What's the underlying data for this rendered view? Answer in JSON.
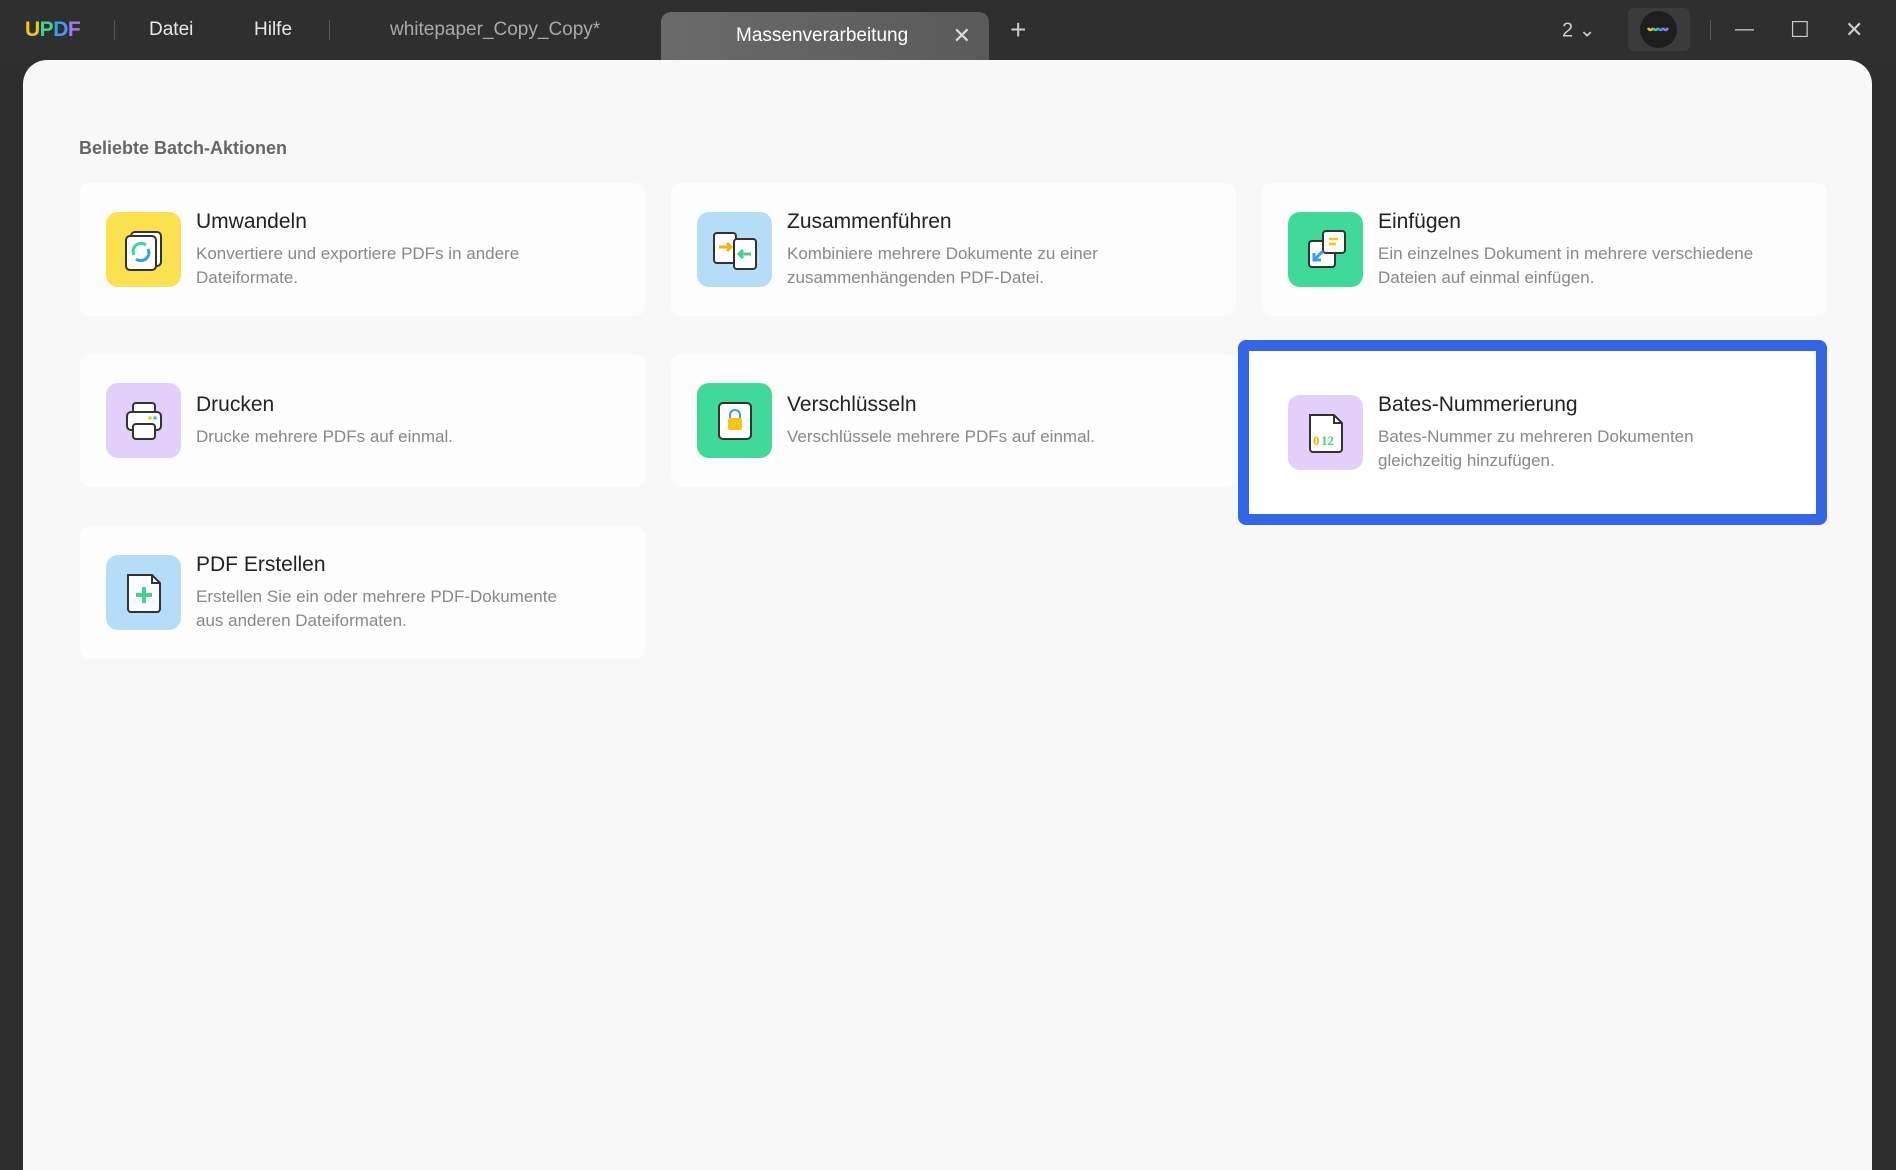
{
  "titlebar": {
    "logo": "UPDF",
    "menu": [
      "Datei",
      "Hilfe"
    ],
    "tabs": [
      {
        "label": "whitepaper_Copy_Copy*",
        "active": false
      },
      {
        "label": "Massenverarbeitung",
        "active": true
      }
    ],
    "add_tab": "+",
    "close_tab": "✕",
    "window_count": "2",
    "window_count_chevron": "⌄",
    "minimize": "—",
    "maximize": "☐",
    "close": "✕"
  },
  "main": {
    "section_title": "Beliebte Batch-Aktionen",
    "cards": [
      {
        "title": "Umwandeln",
        "desc": "Konvertiere und exportiere PDFs in andere Dateiformate.",
        "color": "#fbe04f"
      },
      {
        "title": "Zusammenführen",
        "desc": "Kombiniere mehrere Dokumente zu einer zusammenhängenden PDF-Datei.",
        "color": "#b6ddf7"
      },
      {
        "title": "Einfügen",
        "desc": "Ein einzelnes Dokument in mehrere verschiedene Dateien auf einmal einfügen.",
        "color": "#3fd99a"
      },
      {
        "title": "Drucken",
        "desc": "Drucke mehrere PDFs auf einmal.",
        "color": "#e2d0fa"
      },
      {
        "title": "Verschlüsseln",
        "desc": "Verschlüssele mehrere PDFs auf einmal.",
        "color": "#3fd99a"
      },
      {
        "title": "Bates-Nummerierung",
        "desc": "Bates-Nummer zu mehreren Dokumenten gleichzeitig hinzufügen.",
        "color": "#e2d0fa",
        "icon_text": "012",
        "highlighted": true
      },
      {
        "title": "PDF Erstellen",
        "desc": "Erstellen Sie ein oder mehrere PDF-Dokumente aus anderen Dateiformaten.",
        "color": "#b6ddf7"
      }
    ]
  },
  "colors": {
    "highlight": "#3366e6",
    "titlebar": "#2f2f2f"
  }
}
